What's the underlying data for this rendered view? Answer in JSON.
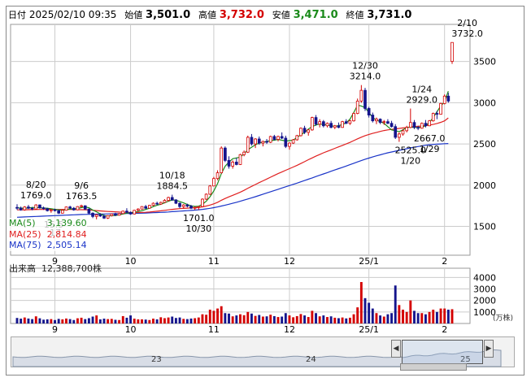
{
  "header": {
    "date_label": "日付",
    "datetime": "2025/02/10 09:35",
    "open_label": "始値",
    "open": "3,501.0",
    "high_label": "高値",
    "high": "3,732.0",
    "low_label": "安値",
    "low": "3,471.0",
    "close_label": "終値",
    "close": "3,731.0"
  },
  "legend": {
    "ma5_label": "MA(5)",
    "ma5_value": "3,139.60",
    "ma25_label": "MA(25)",
    "ma25_value": "2,814.84",
    "ma75_label": "MA(75)",
    "ma75_value": "2,505.14"
  },
  "volume_label": "出来高",
  "volume_value": "12,388,700株",
  "volume_unit": "(万株)",
  "colors": {
    "up": "#d40000",
    "down": "#14148c",
    "ma5": "#1a8a1a",
    "ma25": "#e02020",
    "ma75": "#1a34c8",
    "grid": "#cccccc",
    "label_bg": "#fffff0"
  },
  "chart_data": {
    "type": "candlestick",
    "price_axis": {
      "ticks": [
        1500,
        2000,
        2500,
        3000,
        3500
      ],
      "ylim": [
        1150,
        3950
      ]
    },
    "volume_axis": {
      "ticks": [
        1000,
        2000,
        3000,
        4000
      ],
      "ylim": [
        0,
        4800
      ]
    },
    "x_ticks": [
      {
        "label": "9",
        "index": 10
      },
      {
        "label": "10",
        "index": 30
      },
      {
        "label": "11",
        "index": 52
      },
      {
        "label": "12",
        "index": 72
      },
      {
        "label": "25/1",
        "index": 93
      },
      {
        "label": "2",
        "index": 113
      }
    ],
    "scroll_labels": [
      "23",
      "24",
      "25"
    ],
    "annotations": [
      {
        "index": 5,
        "value": 1769.0,
        "date": "8/20",
        "price": "1769.0",
        "pos": "above"
      },
      {
        "index": 17,
        "value": 1763.5,
        "date": "9/6",
        "price": "1763.5",
        "pos": "above"
      },
      {
        "index": 41,
        "value": 1884.5,
        "date": "10/18",
        "price": "1884.5",
        "pos": "above"
      },
      {
        "index": 48,
        "value": 1701.0,
        "date": "10/30",
        "price": "1701.0",
        "pos": "below"
      },
      {
        "index": 92,
        "value": 3214.0,
        "date": "12/30",
        "price": "3214.0",
        "pos": "above"
      },
      {
        "index": 104,
        "value": 2525.0,
        "date": "1/20",
        "price": "2525.0",
        "pos": "below"
      },
      {
        "index": 107,
        "value": 2929.0,
        "date": "1/24",
        "price": "2929.0",
        "pos": "above"
      },
      {
        "index": 109,
        "value": 2667.0,
        "date": "1/29",
        "price": "2667.0",
        "pos": "below"
      },
      {
        "index": 119,
        "value": 3732.0,
        "date": "2/10",
        "price": "3732.0",
        "pos": "above"
      }
    ],
    "partial_label": "15.5",
    "partial_label2": "17",
    "candles": [
      [
        1730,
        1769,
        1700,
        1720,
        480
      ],
      [
        1720,
        1740,
        1690,
        1700,
        420
      ],
      [
        1700,
        1745,
        1690,
        1735,
        520
      ],
      [
        1735,
        1760,
        1710,
        1720,
        430
      ],
      [
        1720,
        1735,
        1695,
        1710,
        380
      ],
      [
        1710,
        1769,
        1705,
        1760,
        620
      ],
      [
        1760,
        1765,
        1715,
        1725,
        450
      ],
      [
        1725,
        1740,
        1700,
        1715,
        330
      ],
      [
        1715,
        1725,
        1680,
        1690,
        360
      ],
      [
        1690,
        1710,
        1665,
        1700,
        380
      ],
      [
        1700,
        1715,
        1680,
        1690,
        300
      ],
      [
        1690,
        1700,
        1650,
        1660,
        400
      ],
      [
        1660,
        1705,
        1655,
        1695,
        360
      ],
      [
        1695,
        1740,
        1690,
        1735,
        430
      ],
      [
        1735,
        1750,
        1715,
        1720,
        380
      ],
      [
        1720,
        1735,
        1690,
        1700,
        300
      ],
      [
        1700,
        1745,
        1695,
        1740,
        450
      ],
      [
        1740,
        1763,
        1730,
        1750,
        500
      ],
      [
        1750,
        1755,
        1700,
        1710,
        380
      ],
      [
        1710,
        1715,
        1650,
        1660,
        460
      ],
      [
        1660,
        1670,
        1600,
        1620,
        600
      ],
      [
        1620,
        1650,
        1585,
        1640,
        700
      ],
      [
        1640,
        1660,
        1615,
        1625,
        360
      ],
      [
        1625,
        1640,
        1590,
        1600,
        420
      ],
      [
        1600,
        1635,
        1590,
        1630,
        380
      ],
      [
        1630,
        1655,
        1620,
        1650,
        400
      ],
      [
        1650,
        1665,
        1625,
        1635,
        320
      ],
      [
        1635,
        1660,
        1630,
        1655,
        300
      ],
      [
        1655,
        1690,
        1650,
        1685,
        640
      ],
      [
        1685,
        1720,
        1660,
        1670,
        500
      ],
      [
        1670,
        1680,
        1640,
        1650,
        700
      ],
      [
        1650,
        1700,
        1645,
        1695,
        420
      ],
      [
        1695,
        1720,
        1680,
        1710,
        360
      ],
      [
        1710,
        1745,
        1705,
        1740,
        360
      ],
      [
        1740,
        1760,
        1710,
        1720,
        340
      ],
      [
        1720,
        1760,
        1715,
        1755,
        300
      ],
      [
        1755,
        1790,
        1745,
        1780,
        420
      ],
      [
        1780,
        1800,
        1760,
        1770,
        360
      ],
      [
        1770,
        1800,
        1760,
        1790,
        540
      ],
      [
        1790,
        1830,
        1785,
        1815,
        460
      ],
      [
        1815,
        1860,
        1800,
        1850,
        520
      ],
      [
        1850,
        1884,
        1810,
        1820,
        600
      ],
      [
        1820,
        1830,
        1770,
        1780,
        480
      ],
      [
        1780,
        1790,
        1720,
        1740,
        520
      ],
      [
        1740,
        1770,
        1720,
        1760,
        400
      ],
      [
        1760,
        1775,
        1730,
        1745,
        380
      ],
      [
        1745,
        1760,
        1710,
        1720,
        430
      ],
      [
        1720,
        1740,
        1700,
        1730,
        460
      ],
      [
        1730,
        1745,
        1701,
        1740,
        520
      ],
      [
        1740,
        1840,
        1735,
        1830,
        800
      ],
      [
        1830,
        1900,
        1820,
        1890,
        760
      ],
      [
        1890,
        2000,
        1880,
        1990,
        1200
      ],
      [
        1990,
        2100,
        1985,
        2080,
        1100
      ],
      [
        2080,
        2180,
        2060,
        2150,
        1300
      ],
      [
        2150,
        2470,
        2140,
        2450,
        1500
      ],
      [
        2450,
        2470,
        2280,
        2300,
        900
      ],
      [
        2300,
        2350,
        2200,
        2230,
        860
      ],
      [
        2230,
        2300,
        2200,
        2280,
        620
      ],
      [
        2280,
        2330,
        2240,
        2250,
        700
      ],
      [
        2250,
        2380,
        2245,
        2370,
        800
      ],
      [
        2370,
        2420,
        2350,
        2400,
        720
      ],
      [
        2400,
        2600,
        2390,
        2580,
        1000
      ],
      [
        2580,
        2620,
        2480,
        2500,
        860
      ],
      [
        2500,
        2570,
        2450,
        2560,
        660
      ],
      [
        2560,
        2590,
        2490,
        2510,
        740
      ],
      [
        2510,
        2540,
        2470,
        2530,
        600
      ],
      [
        2530,
        2560,
        2500,
        2520,
        620
      ],
      [
        2520,
        2600,
        2510,
        2590,
        760
      ],
      [
        2590,
        2610,
        2540,
        2555,
        640
      ],
      [
        2555,
        2600,
        2530,
        2590,
        560
      ],
      [
        2590,
        2640,
        2560,
        2570,
        600
      ],
      [
        2570,
        2600,
        2450,
        2470,
        900
      ],
      [
        2470,
        2520,
        2430,
        2510,
        700
      ],
      [
        2510,
        2560,
        2500,
        2550,
        540
      ],
      [
        2550,
        2610,
        2540,
        2600,
        640
      ],
      [
        2600,
        2700,
        2590,
        2690,
        820
      ],
      [
        2690,
        2720,
        2620,
        2640,
        700
      ],
      [
        2640,
        2680,
        2600,
        2670,
        560
      ],
      [
        2670,
        2830,
        2660,
        2820,
        1100
      ],
      [
        2820,
        2850,
        2720,
        2740,
        900
      ],
      [
        2740,
        2800,
        2700,
        2770,
        620
      ],
      [
        2770,
        2790,
        2700,
        2720,
        700
      ],
      [
        2720,
        2760,
        2700,
        2750,
        560
      ],
      [
        2750,
        2780,
        2690,
        2700,
        620
      ],
      [
        2700,
        2730,
        2680,
        2720,
        500
      ],
      [
        2720,
        2760,
        2690,
        2700,
        460
      ],
      [
        2700,
        2780,
        2695,
        2770,
        520
      ],
      [
        2770,
        2800,
        2740,
        2750,
        440
      ],
      [
        2750,
        2790,
        2730,
        2780,
        500
      ],
      [
        2780,
        2880,
        2770,
        2870,
        800
      ],
      [
        2870,
        3050,
        2860,
        3020,
        1400
      ],
      [
        3020,
        3214,
        3000,
        3150,
        3600
      ],
      [
        3150,
        3180,
        2900,
        2930,
        2200
      ],
      [
        2930,
        2950,
        2820,
        2850,
        1800
      ],
      [
        2850,
        2880,
        2760,
        2780,
        1300
      ],
      [
        2780,
        2820,
        2740,
        2800,
        900
      ],
      [
        2800,
        2810,
        2740,
        2760,
        700
      ],
      [
        2760,
        2790,
        2730,
        2770,
        600
      ],
      [
        2770,
        2800,
        2740,
        2750,
        800
      ],
      [
        2750,
        2780,
        2700,
        2710,
        900
      ],
      [
        2710,
        2740,
        2560,
        2580,
        3300
      ],
      [
        2580,
        2640,
        2525,
        2620,
        1600
      ],
      [
        2620,
        2680,
        2600,
        2660,
        1200
      ],
      [
        2660,
        2720,
        2640,
        2700,
        1000
      ],
      [
        2700,
        2929,
        2690,
        2760,
        2000
      ],
      [
        2760,
        2790,
        2680,
        2700,
        1100
      ],
      [
        2700,
        2720,
        2667,
        2690,
        900
      ],
      [
        2690,
        2760,
        2685,
        2750,
        900
      ],
      [
        2750,
        2790,
        2700,
        2720,
        800
      ],
      [
        2720,
        2790,
        2715,
        2780,
        1000
      ],
      [
        2780,
        2880,
        2770,
        2870,
        1200
      ],
      [
        2870,
        2900,
        2800,
        2860,
        1000
      ],
      [
        2860,
        3000,
        2855,
        2990,
        1300
      ],
      [
        2990,
        3100,
        2980,
        3080,
        1300
      ],
      [
        3080,
        3120,
        3000,
        3020,
        1200
      ],
      [
        3501,
        3732,
        3471,
        3731,
        1239
      ]
    ],
    "ma5_series": [
      1725,
      1722,
      1718,
      1724,
      1728,
      1730,
      1726,
      1722,
      1720,
      1713,
      1706,
      1700,
      1695,
      1702,
      1710,
      1712,
      1716,
      1728,
      1735,
      1726,
      1698,
      1676,
      1652,
      1630,
      1625,
      1630,
      1632,
      1640,
      1650,
      1660,
      1665,
      1672,
      1680,
      1690,
      1705,
      1720,
      1740,
      1755,
      1768,
      1785,
      1805,
      1820,
      1817,
      1802,
      1785,
      1765,
      1748,
      1742,
      1745,
      1767,
      1805,
      1860,
      1930,
      2020,
      2140,
      2230,
      2280,
      2320,
      2330,
      2340,
      2380,
      2430,
      2460,
      2490,
      2510,
      2520,
      2530,
      2540,
      2545,
      2555,
      2545,
      2535,
      2540,
      2545,
      2580,
      2610,
      2640,
      2680,
      2710,
      2730,
      2740,
      2735,
      2730,
      2720,
      2715,
      2722,
      2735,
      2755,
      2800,
      2880,
      2970,
      2960,
      2940,
      2880,
      2820,
      2790,
      2770,
      2750,
      2710,
      2670,
      2660,
      2650,
      2670,
      2700,
      2705,
      2700,
      2700,
      2705,
      2720,
      2760,
      2820,
      2890,
      2960,
      3010,
      3139.6
    ],
    "ma25_series": [
      1700,
      1700,
      1701,
      1702,
      1703,
      1704,
      1705,
      1705,
      1706,
      1706,
      1706,
      1705,
      1705,
      1705,
      1705,
      1704,
      1703,
      1702,
      1701,
      1699,
      1695,
      1691,
      1687,
      1683,
      1680,
      1678,
      1676,
      1674,
      1672,
      1670,
      1669,
      1668,
      1668,
      1669,
      1671,
      1674,
      1678,
      1683,
      1688,
      1694,
      1700,
      1706,
      1711,
      1715,
      1718,
      1721,
      1724,
      1727,
      1731,
      1737,
      1746,
      1758,
      1773,
      1792,
      1816,
      1838,
      1858,
      1877,
      1895,
      1915,
      1937,
      1962,
      1985,
      2008,
      2030,
      2052,
      2074,
      2096,
      2118,
      2140,
      2160,
      2180,
      2200,
      2220,
      2240,
      2262,
      2285,
      2308,
      2330,
      2352,
      2372,
      2392,
      2410,
      2428,
      2446,
      2464,
      2482,
      2500,
      2518,
      2540,
      2562,
      2582,
      2600,
      2615,
      2628,
      2640,
      2652,
      2662,
      2670,
      2676,
      2682,
      2688,
      2694,
      2700,
      2706,
      2710,
      2714,
      2718,
      2722,
      2728,
      2736,
      2748,
      2762,
      2780,
      2814.84
    ],
    "ma75_series": [
      1610,
      1612,
      1614,
      1616,
      1618,
      1620,
      1622,
      1624,
      1626,
      1628,
      1630,
      1632,
      1634,
      1636,
      1638,
      1640,
      1642,
      1644,
      1645,
      1646,
      1647,
      1648,
      1649,
      1650,
      1651,
      1652,
      1653,
      1654,
      1655,
      1656,
      1657,
      1658,
      1659,
      1660,
      1662,
      1664,
      1666,
      1668,
      1670,
      1672,
      1675,
      1678,
      1681,
      1684,
      1687,
      1690,
      1693,
      1697,
      1701,
      1706,
      1712,
      1719,
      1727,
      1736,
      1746,
      1757,
      1768,
      1780,
      1792,
      1805,
      1818,
      1832,
      1846,
      1860,
      1875,
      1890,
      1905,
      1920,
      1935,
      1950,
      1965,
      1980,
      1995,
      2010,
      2025,
      2040,
      2056,
      2072,
      2088,
      2104,
      2120,
      2136,
      2152,
      2168,
      2184,
      2200,
      2216,
      2232,
      2248,
      2265,
      2282,
      2298,
      2314,
      2328,
      2342,
      2356,
      2368,
      2380,
      2392,
      2402,
      2412,
      2422,
      2432,
      2442,
      2452,
      2460,
      2468,
      2476,
      2484,
      2490,
      2494,
      2497,
      2500,
      2503,
      2505.14
    ]
  }
}
